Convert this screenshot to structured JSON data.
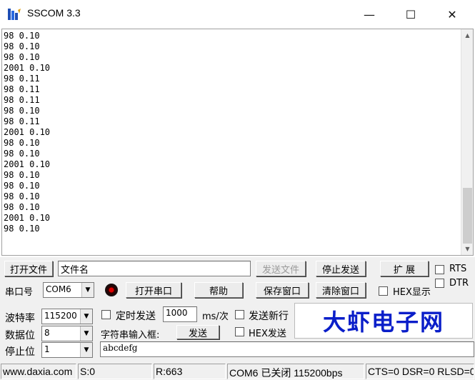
{
  "window": {
    "title": "SSCOM 3.3",
    "minimize": "—",
    "maximize": "☐",
    "close": "✕"
  },
  "output_lines": [
    "98 0.10",
    "98 0.10",
    "98 0.10",
    "2001 0.10",
    "98 0.11",
    "98 0.11",
    "98 0.11",
    "98 0.10",
    "98 0.11",
    "2001 0.10",
    "98 0.10",
    "98 0.10",
    "2001 0.10",
    "98 0.10",
    "98 0.10",
    "98 0.10",
    "98 0.10",
    "2001 0.10",
    "98 0.10"
  ],
  "toolbar": {
    "open_file": "打开文件",
    "filename_value": "文件名",
    "send_file": "发送文件",
    "stop_send": "停止发送",
    "expand": "扩 展",
    "rts": "RTS",
    "dtr": "DTR",
    "port_label": "串口号",
    "port_value": "COM6",
    "open_port": "打开串口",
    "help": "帮助",
    "save_window": "保存窗口",
    "clear_window": "清除窗口",
    "hex_display": "HEX显示"
  },
  "settings": {
    "baud_label": "波特率",
    "baud_value": "115200",
    "data_bits_label": "数据位",
    "data_bits_value": "8",
    "stop_bits_label": "停止位",
    "stop_bits_value": "1",
    "timed_send": "定时发送",
    "interval_value": "1000",
    "interval_unit": "ms/次",
    "send_newline": "发送新行",
    "input_label": "字符串输入框:",
    "send": "发送",
    "hex_send": "HEX发送",
    "input_value": "abcdefg"
  },
  "banner": {
    "text": "大虾电子网"
  },
  "status": {
    "site": "www.daxia.com",
    "sent": "S:0",
    "received": "R:663",
    "port_state": "COM6 已关闭  115200bps",
    "signals": "CTS=0 DSR=0 RLSD=0"
  },
  "colors": {
    "banner_text": "#0a1ec9",
    "led": "#dd0000"
  }
}
